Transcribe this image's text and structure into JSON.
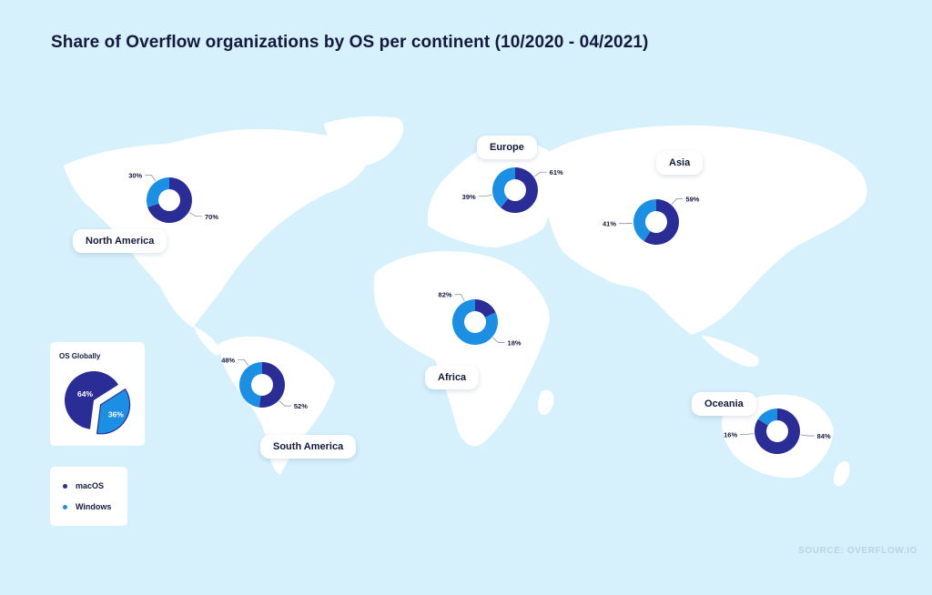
{
  "title": "Share of Overflow organizations by OS per continent (10/2020 - 04/2021)",
  "source": "SOURCE: OVERFLOW.IO",
  "colors": {
    "macos": "#2a2d96",
    "windows": "#1a8fe3",
    "background": "#d6f0fc",
    "land": "#ffffff"
  },
  "legend": {
    "items": [
      {
        "label": "macOS",
        "color": "#2a2d96"
      },
      {
        "label": "Windows",
        "color": "#1a8fe3"
      }
    ]
  },
  "chart_data": [
    {
      "type": "pie",
      "name": "OS Globally",
      "labels": [
        "macOS",
        "Windows"
      ],
      "values": [
        64,
        36
      ],
      "value_labels": [
        "64%",
        "36%"
      ]
    },
    {
      "type": "pie",
      "name": "North America",
      "labels": [
        "macOS",
        "Windows"
      ],
      "values": [
        70,
        30
      ],
      "value_labels": [
        "70%",
        "30%"
      ]
    },
    {
      "type": "pie",
      "name": "South America",
      "labels": [
        "macOS",
        "Windows"
      ],
      "values": [
        52,
        48
      ],
      "value_labels": [
        "52%",
        "48%"
      ]
    },
    {
      "type": "pie",
      "name": "Europe",
      "labels": [
        "macOS",
        "Windows"
      ],
      "values": [
        61,
        39
      ],
      "value_labels": [
        "61%",
        "39%"
      ]
    },
    {
      "type": "pie",
      "name": "Africa",
      "labels": [
        "macOS",
        "Windows"
      ],
      "values": [
        18,
        82
      ],
      "value_labels": [
        "18%",
        "82%"
      ]
    },
    {
      "type": "pie",
      "name": "Asia",
      "labels": [
        "macOS",
        "Windows"
      ],
      "values": [
        59,
        41
      ],
      "value_labels": [
        "59%",
        "41%"
      ]
    },
    {
      "type": "pie",
      "name": "Oceania",
      "labels": [
        "macOS",
        "Windows"
      ],
      "values": [
        84,
        16
      ],
      "value_labels": [
        "84%",
        "16%"
      ]
    }
  ]
}
